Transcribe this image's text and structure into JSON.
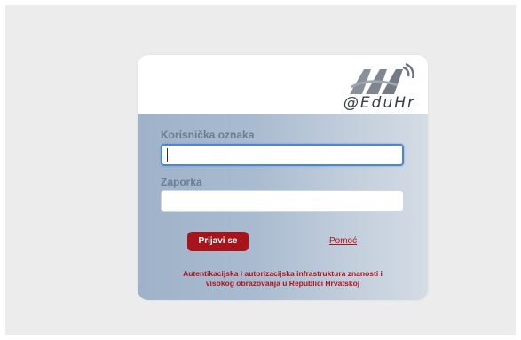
{
  "logo": {
    "brand_text": "@EduHr",
    "icon_name": "aai-logo-icon"
  },
  "form": {
    "username_label": "Korisnička oznaka",
    "username_value": "",
    "password_label": "Zaporka",
    "password_value": "",
    "submit_label": "Prijavi se",
    "help_label": "Pomoć"
  },
  "footer": {
    "line1": "Autentikacijska i autorizacijska infrastruktura znanosti i",
    "line2": "visokog obrazovanja u Republici Hrvatskoj"
  },
  "colors": {
    "accent": "#a8141b",
    "focus_border": "#4a87d6",
    "label": "#6a7c92"
  }
}
